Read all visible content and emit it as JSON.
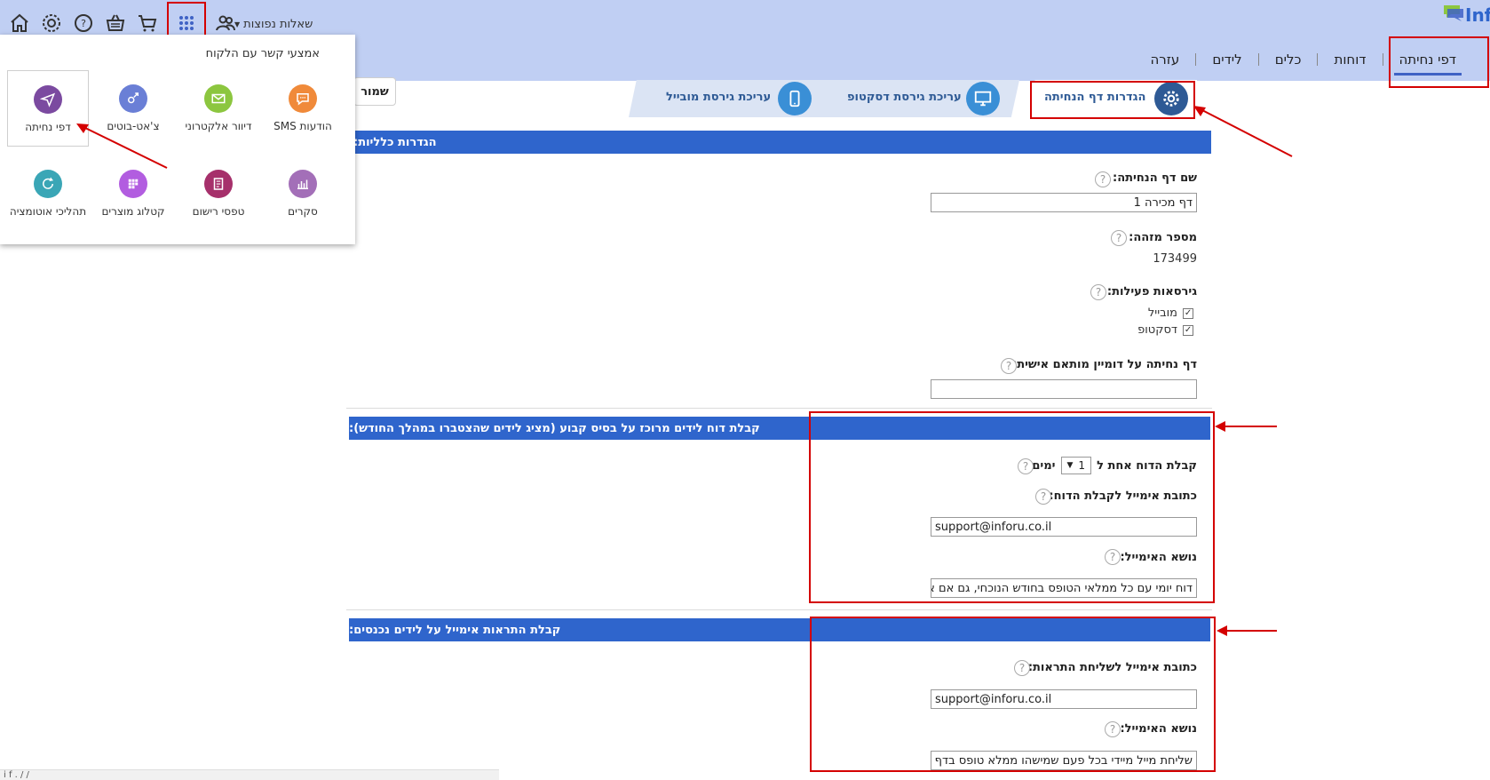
{
  "header": {
    "faq_label": "שאלות נפוצות",
    "logo_text": "Inf",
    "nav": [
      "דפי נחיתה",
      "דוחות",
      "כלים",
      "לידים",
      "עזרה"
    ]
  },
  "steps": {
    "settings": "הגדרות דף הנחיתה",
    "desktop": "עריכת גירסת דסקטופ",
    "mobile": "עריכת גירסת מובייל",
    "save": "שמור"
  },
  "general": {
    "title": "הגדרות כלליות:",
    "name_label": "שם דף הנחיתה:",
    "name_value": "דף מכירה 1",
    "id_label": "מספר מזהה:",
    "id_value": "173499",
    "versions_label": "גירסאות פעילות:",
    "version_mobile": "מובייל",
    "version_desktop": "דסקטופ",
    "domain_label": "דף נחיתה על דומיין מותאם אישית:",
    "domain_value": ""
  },
  "report": {
    "title": "קבלת דוח לידים מרוכז על בסיס קבוע (מציג לידים שהצטברו במהלך החודש):",
    "freq_prefix": "קבלת הדוח אחת ל",
    "freq_value": "1",
    "freq_suffix": "ימים",
    "email_label": "כתובת אימייל לקבלת הדוח:",
    "email_value": "support@inforu.co.il",
    "subject_label": "נושא האימייל:",
    "subject_value": "דוח יומי עם כל ממלאי הטופס בחודש הנוכחי, גם אם אין!"
  },
  "alerts": {
    "title": "קבלת התראות אימייל על לידים נכנסים:",
    "email_label": "כתובת אימייל לשליחת התראות:",
    "email_value": "support@inforu.co.il",
    "subject_label": "נושא האימייל:",
    "subject_value": "שליחת מייל מיידי בכל פעם שמישהו ממלא טופס בדף"
  },
  "apps_menu": {
    "title": "אמצעי קשר עם הלקוח",
    "items": [
      "הודעות SMS",
      "דיוור אלקטרוני",
      "צ'אט-בוטים",
      "דפי נחיתה",
      "סקרים",
      "טפסי רישום",
      "קטלוג מוצרים",
      "תהליכי אוטומציה"
    ]
  },
  "status_text": "i  f   .   /  /",
  "colors": {
    "header_bg": "#c0cff3",
    "section_bar": "#2f65cc",
    "annotation_red": "#d40000",
    "sms": "#f08a3a",
    "email": "#8cc63f",
    "chatbots": "#6a7fd6",
    "landing": "#7b4aa0",
    "surveys": "#a36fb8",
    "forms": "#a6306b",
    "catalog": "#b25de0",
    "automation": "#3aa6b6"
  }
}
